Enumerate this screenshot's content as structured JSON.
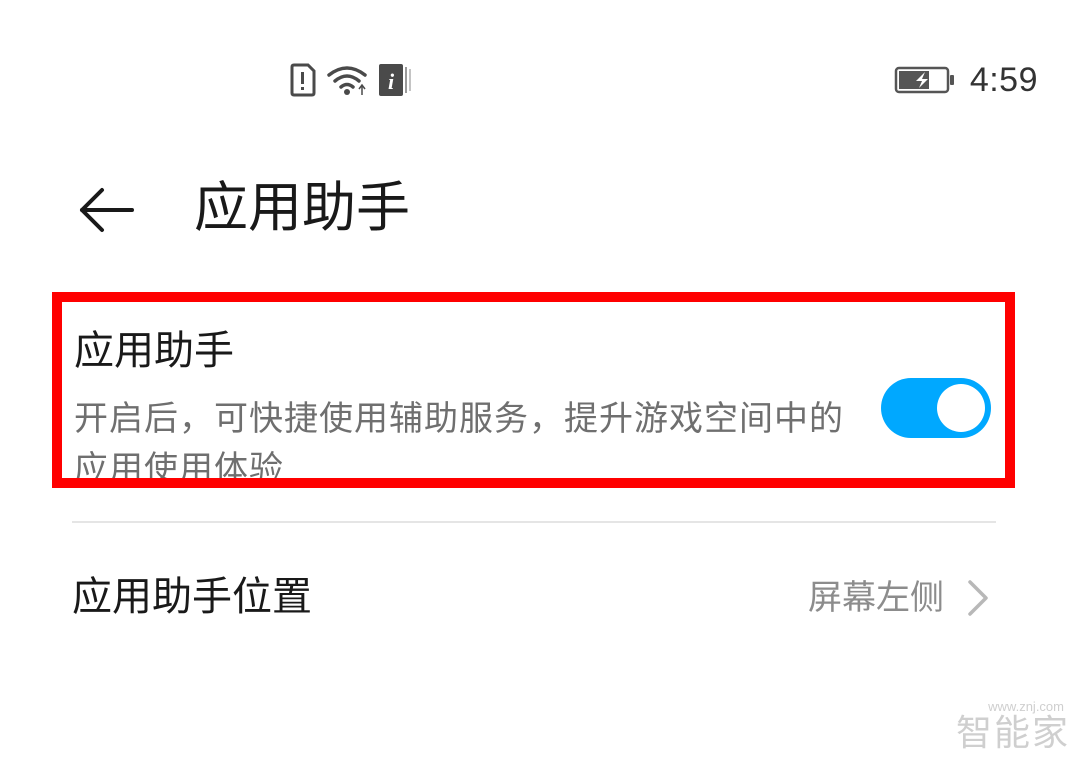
{
  "status_bar": {
    "time": "4:59",
    "icons": [
      "sim-alert-icon",
      "wifi-icon",
      "info-icon",
      "battery-charging-icon"
    ]
  },
  "header": {
    "title": "应用助手",
    "back_icon": "back-arrow-icon"
  },
  "settings": {
    "assistant_toggle": {
      "title": "应用助手",
      "description": "开启后，可快捷使用辅助服务，提升游戏空间中的应用使用体验",
      "enabled": true
    },
    "assistant_position": {
      "title": "应用助手位置",
      "value": "屏幕左侧"
    }
  },
  "colors": {
    "accent": "#00a8ff",
    "highlight": "#ff0000"
  },
  "watermark": {
    "logo": "智能家",
    "url": "www.znj.com"
  }
}
